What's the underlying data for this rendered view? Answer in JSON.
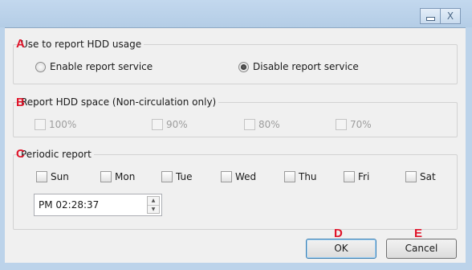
{
  "window": {
    "caption_min": "minimize",
    "caption_close": "X"
  },
  "markers": {
    "a": "A",
    "b": "B",
    "c": "C",
    "d": "D",
    "e": "E"
  },
  "groups": {
    "hdd_usage": {
      "title": "Use to report HDD usage",
      "options": [
        {
          "label": "Enable report service",
          "selected": false
        },
        {
          "label": "Disable report service",
          "selected": true
        }
      ]
    },
    "hdd_space": {
      "title": "Report HDD space (Non-circulation only)",
      "options": [
        "100%",
        "90%",
        "80%",
        "70%"
      ]
    },
    "periodic": {
      "title": "Periodic report",
      "days": [
        "Sun",
        "Mon",
        "Tue",
        "Wed",
        "Thu",
        "Fri",
        "Sat"
      ],
      "time": "PM 02:28:37"
    }
  },
  "buttons": {
    "ok": "OK",
    "cancel": "Cancel"
  },
  "icons": {
    "spin_up": "▲",
    "spin_down": "▼"
  }
}
